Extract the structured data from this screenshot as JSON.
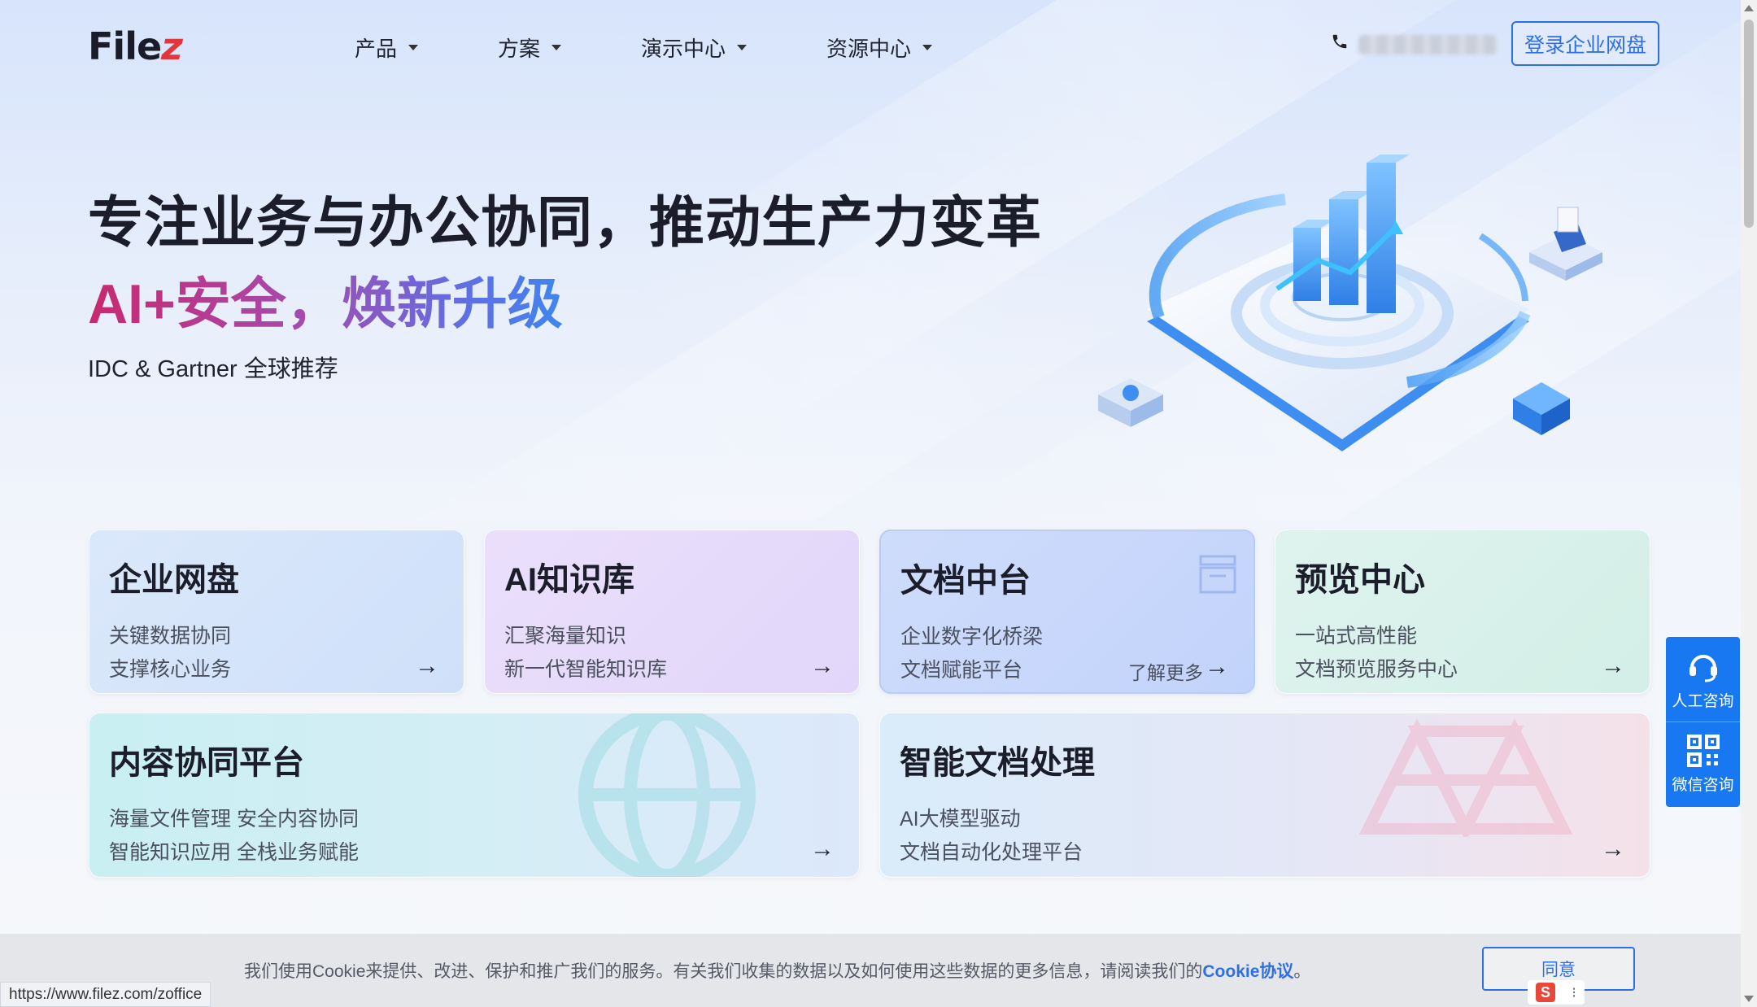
{
  "header": {
    "logo_main": "File",
    "logo_z": "z",
    "nav": [
      "产品",
      "方案",
      "演示中心",
      "资源中心"
    ],
    "login_label": "登录企业网盘"
  },
  "hero": {
    "title": "专注业务与办公协同，推动生产力变革",
    "subtitle": "AI+安全，焕新升级",
    "note": "IDC & Gartner 全球推荐"
  },
  "cards": [
    {
      "title": "企业网盘",
      "line1": "关键数据协同",
      "line2": "支撑核心业务"
    },
    {
      "title": "AI知识库",
      "line1": "汇聚海量知识",
      "line2": "新一代智能知识库"
    },
    {
      "title": "文档中台",
      "line1": "企业数字化桥梁",
      "line2": "文档赋能平台",
      "more": "了解更多"
    },
    {
      "title": "预览中心",
      "line1": "一站式高性能",
      "line2": "文档预览服务中心"
    },
    {
      "title": "内容协同平台",
      "line1": "海量文件管理 安全内容协同",
      "line2": "智能知识应用 全栈业务赋能"
    },
    {
      "title": "智能文档处理",
      "line1": "AI大模型驱动",
      "line2": "文档自动化处理平台"
    }
  ],
  "side_float": {
    "service_label": "人工咨询",
    "wechat_label": "微信咨询"
  },
  "cookie": {
    "text": "我们使用Cookie来提供、改进、保护和推广我们的服务。有关我们收集的数据以及如何使用这些数据的更多信息，请阅读我们的",
    "link": "Cookie协议",
    "end": "。",
    "agree": "同意"
  },
  "status_url": "https://www.filez.com/zoffice",
  "colors": {
    "accent": "#2f6fe6",
    "float_blue": "#1778f2",
    "logo_z": "#e2363c"
  }
}
